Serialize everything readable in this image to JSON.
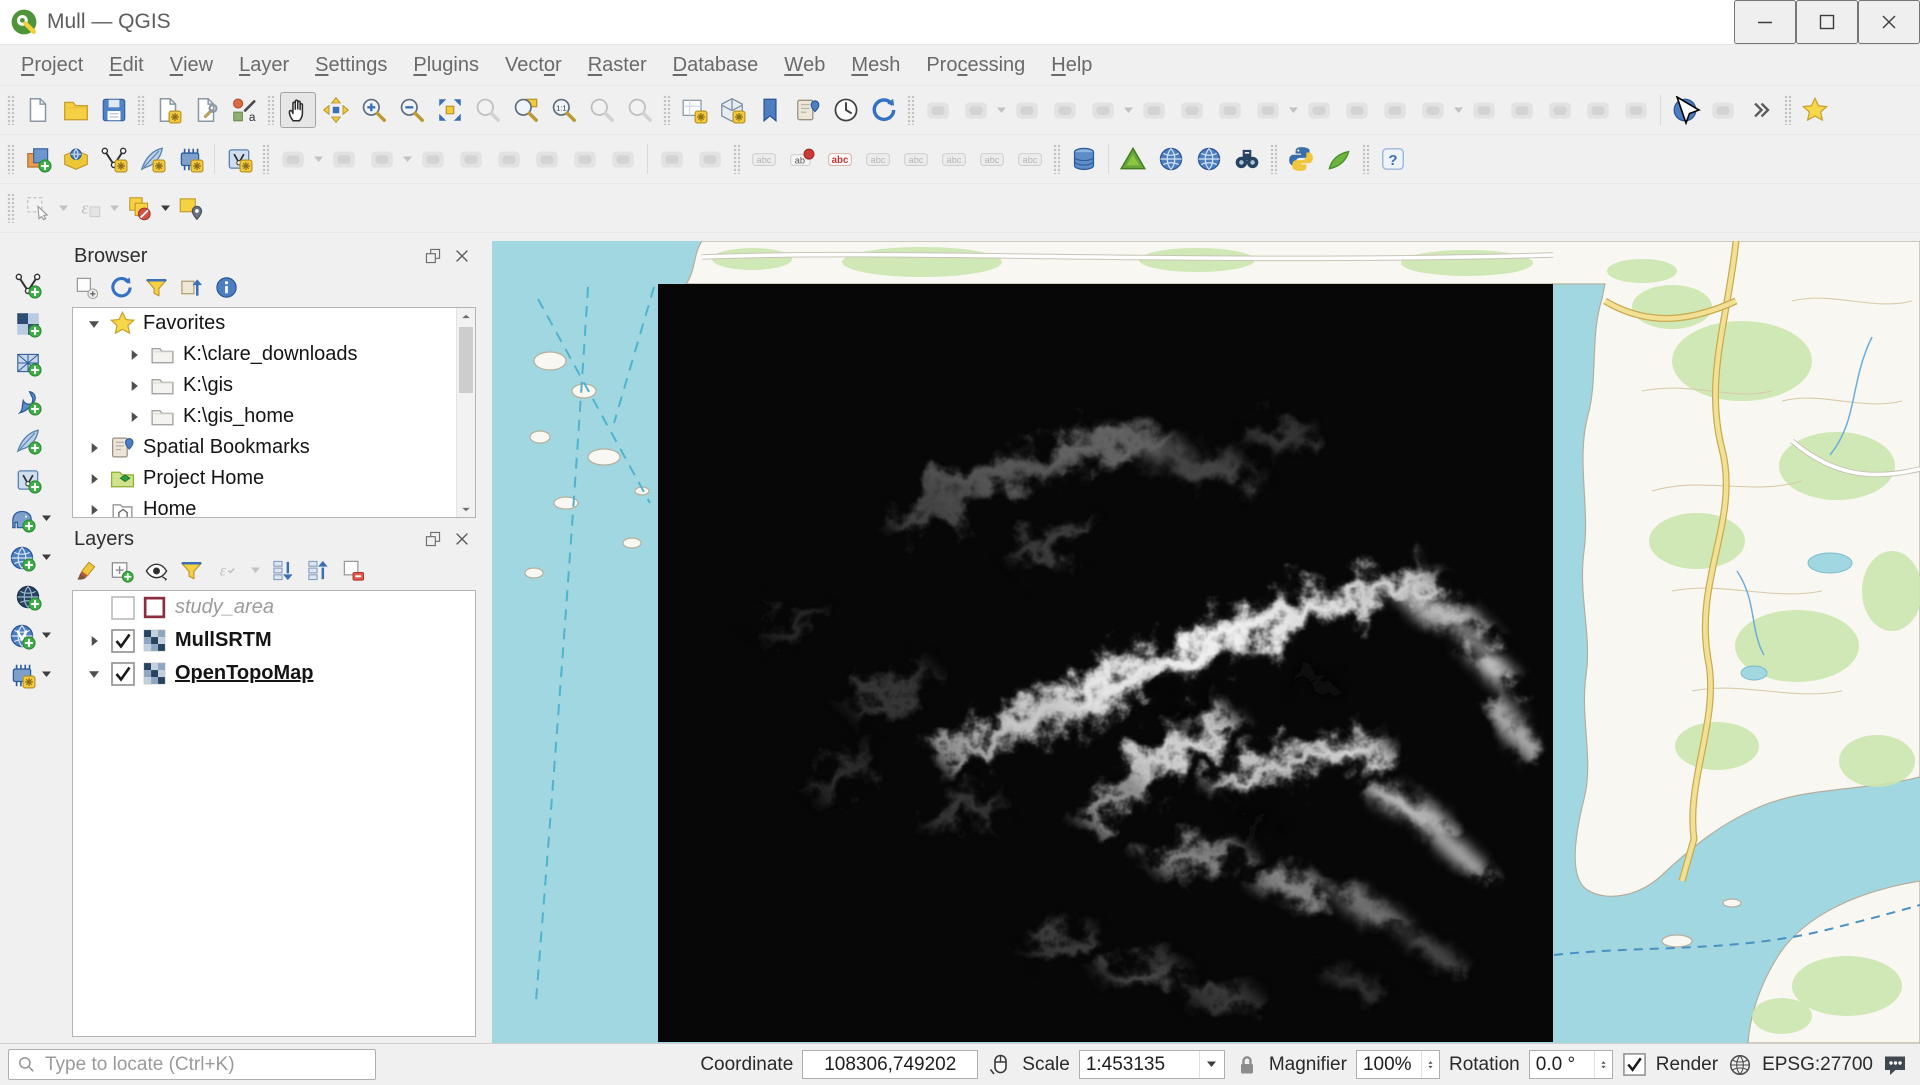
{
  "window": {
    "title": "Mull — QGIS"
  },
  "menu": {
    "items": [
      {
        "label": "Project",
        "u": 0
      },
      {
        "label": "Edit",
        "u": 0
      },
      {
        "label": "View",
        "u": 0
      },
      {
        "label": "Layer",
        "u": 0
      },
      {
        "label": "Settings",
        "u": 0
      },
      {
        "label": "Plugins",
        "u": 0
      },
      {
        "label": "Vector",
        "u": 4
      },
      {
        "label": "Raster",
        "u": 0
      },
      {
        "label": "Database",
        "u": 0
      },
      {
        "label": "Web",
        "u": 0
      },
      {
        "label": "Mesh",
        "u": 0
      },
      {
        "label": "Processing",
        "u": 3
      },
      {
        "label": "Help",
        "u": 0
      }
    ]
  },
  "toolbar1": [
    {
      "t": "handle"
    },
    {
      "n": "new-project",
      "i": "page"
    },
    {
      "n": "open-project",
      "i": "folder"
    },
    {
      "n": "save-project",
      "i": "floppy"
    },
    {
      "t": "handle"
    },
    {
      "n": "new-print-layout",
      "i": "pageStar"
    },
    {
      "n": "show-layout-manager",
      "i": "pageWrench"
    },
    {
      "n": "style-manager",
      "i": "styleMgr"
    },
    {
      "t": "handle"
    },
    {
      "n": "pan-map",
      "i": "hand",
      "pressed": true
    },
    {
      "n": "pan-map-to-selection",
      "i": "move"
    },
    {
      "n": "zoom-in",
      "i": "magPlus"
    },
    {
      "n": "zoom-out",
      "i": "magMinus"
    },
    {
      "n": "zoom-full",
      "i": "zoomFull"
    },
    {
      "n": "zoom-to-selection",
      "i": "magGray"
    },
    {
      "n": "zoom-to-layer",
      "i": "magLayer"
    },
    {
      "n": "zoom-to-native",
      "i": "mag11"
    },
    {
      "n": "zoom-last",
      "i": "magGray"
    },
    {
      "n": "zoom-next",
      "i": "magGray"
    },
    {
      "t": "handle"
    },
    {
      "n": "new-map-view",
      "i": "mapView"
    },
    {
      "n": "new-3d-map-view",
      "i": "cube3d"
    },
    {
      "n": "new-spatial-bookmark",
      "i": "bookmarkBlue"
    },
    {
      "n": "show-spatial-bookmarks",
      "i": "bookPin"
    },
    {
      "n": "temporal-controller",
      "i": "clock"
    },
    {
      "n": "refresh-map",
      "i": "refresh"
    },
    {
      "t": "handle"
    },
    {
      "n": "inactive-tool-1",
      "i": "genericGray"
    },
    {
      "n": "inactive-tool-2",
      "i": "genericGray",
      "caret": "dim"
    },
    {
      "n": "inactive-tool-3",
      "i": "genericGray"
    },
    {
      "n": "inactive-tool-4",
      "i": "genericGray"
    },
    {
      "n": "inactive-tool-5",
      "i": "genericGray",
      "caret": "dim"
    },
    {
      "n": "inactive-tool-6",
      "i": "genericGray"
    },
    {
      "n": "inactive-tool-7",
      "i": "genericGray"
    },
    {
      "n": "inactive-tool-8",
      "i": "genericGray"
    },
    {
      "n": "inactive-tool-9",
      "i": "genericGray",
      "caret": "dim"
    },
    {
      "n": "inactive-tool-10",
      "i": "genericGray"
    },
    {
      "n": "inactive-tool-11",
      "i": "genericGray"
    },
    {
      "n": "inactive-tool-12",
      "i": "genericGray"
    },
    {
      "n": "inactive-tool-13",
      "i": "genericGray",
      "caret": "dim"
    },
    {
      "n": "inactive-tool-14",
      "i": "genericGray"
    },
    {
      "n": "inactive-tool-15",
      "i": "genericGray"
    },
    {
      "n": "inactive-tool-16",
      "i": "genericGray"
    },
    {
      "n": "inactive-tool-17",
      "i": "genericGray"
    },
    {
      "n": "inactive-tool-18",
      "i": "genericGray"
    },
    {
      "t": "sep"
    },
    {
      "n": "information-tool",
      "i": "infoBlue"
    },
    {
      "n": "inactive-tool-19",
      "i": "genericGray"
    },
    {
      "n": "toolbar-overflow",
      "i": "chevrons"
    },
    {
      "t": "handle"
    },
    {
      "n": "favorites",
      "i": "star"
    }
  ],
  "toolbar2": [
    {
      "t": "handle"
    },
    {
      "n": "open-data-source-manager",
      "i": "stackPlus"
    },
    {
      "n": "browser-data-source",
      "i": "boxGlobe"
    },
    {
      "n": "add-vector-layer",
      "i": "vnodeY"
    },
    {
      "n": "add-spatialite-layer",
      "i": "featherY"
    },
    {
      "n": "add-mesh-layer",
      "i": "chipY"
    },
    {
      "t": "sep"
    },
    {
      "n": "add-virtual-layer",
      "i": "vboxY"
    },
    {
      "t": "handle"
    },
    {
      "n": "current-edits",
      "i": "genericGray",
      "caret": "dim"
    },
    {
      "n": "toggle-editing",
      "i": "genericGray"
    },
    {
      "n": "save-layer-edits",
      "i": "genericGray",
      "caret": "dim"
    },
    {
      "n": "digitize-tool-1",
      "i": "genericGray"
    },
    {
      "n": "digitize-tool-2",
      "i": "genericGray"
    },
    {
      "n": "delete-selected",
      "i": "genericGray"
    },
    {
      "n": "cut-features",
      "i": "genericGray"
    },
    {
      "n": "copy-features",
      "i": "genericGray"
    },
    {
      "n": "paste-features",
      "i": "genericGray"
    },
    {
      "t": "sep"
    },
    {
      "n": "undo",
      "i": "genericGray"
    },
    {
      "n": "redo",
      "i": "genericGray"
    },
    {
      "t": "handle"
    },
    {
      "n": "label-tool-1",
      "i": "pillGray"
    },
    {
      "n": "highlight-pinned-labels",
      "i": "pillRedDot"
    },
    {
      "n": "layer-labeling",
      "i": "pillAbcRed"
    },
    {
      "n": "label-tool-2",
      "i": "pillGray"
    },
    {
      "n": "label-tool-3",
      "i": "pillGray"
    },
    {
      "n": "label-tool-4",
      "i": "pillGray"
    },
    {
      "n": "label-tool-5",
      "i": "pillGray"
    },
    {
      "n": "label-tool-6",
      "i": "pillGray"
    },
    {
      "t": "handle"
    },
    {
      "n": "db-manager",
      "i": "dbCyl"
    },
    {
      "t": "sep"
    },
    {
      "n": "grass-tools",
      "i": "grass"
    },
    {
      "n": "web-service-1",
      "i": "globe"
    },
    {
      "n": "web-service-2",
      "i": "globe"
    },
    {
      "n": "osm-place-search",
      "i": "binoculars"
    },
    {
      "t": "handle"
    },
    {
      "n": "python-console",
      "i": "python"
    },
    {
      "n": "processing-toolbox",
      "i": "greenPoly"
    },
    {
      "t": "handle"
    },
    {
      "n": "help-contents",
      "i": "help"
    }
  ],
  "toolbar3": [
    {
      "t": "handle"
    },
    {
      "n": "select-features",
      "i": "selectRect",
      "caret": "dim"
    },
    {
      "n": "select-by-expression",
      "i": "epsilonSel",
      "caret": "dim"
    },
    {
      "n": "deselect-all",
      "i": "yellowSquares",
      "caret": "dark"
    },
    {
      "n": "select-by-value",
      "i": "yellowPin"
    }
  ],
  "left_toolbar": [
    {
      "n": "add-vector-layer",
      "i": "vnodeG"
    },
    {
      "n": "add-raster-layer",
      "i": "rasterG"
    },
    {
      "n": "add-mesh-layer",
      "i": "meshG"
    },
    {
      "n": "add-delimited-text-layer",
      "i": "commaG"
    },
    {
      "n": "add-spatialite-layer",
      "i": "featherG"
    },
    {
      "n": "add-virtual-layer",
      "i": "vboxG"
    },
    {
      "n": "add-postgis-layer",
      "i": "elephantG",
      "caret": "dark"
    },
    {
      "n": "add-wms-layer",
      "i": "globeG",
      "caret": "dark"
    },
    {
      "n": "add-wcs-layer",
      "i": "globeDarkG"
    },
    {
      "n": "add-wfs-layer",
      "i": "globeVG",
      "caret": "dark"
    },
    {
      "n": "add-mesh-chip-layer",
      "i": "chipY",
      "caret": "dark"
    }
  ],
  "browser": {
    "title": "Browser",
    "tools": [
      {
        "n": "add-selected-layers",
        "i": "squarePlus"
      },
      {
        "n": "refresh-browser",
        "i": "refresh"
      },
      {
        "n": "filter-browser",
        "i": "funnel"
      },
      {
        "n": "collapse-all",
        "i": "collapseFolder"
      },
      {
        "n": "enable-properties",
        "i": "infoBlue"
      }
    ],
    "items": [
      {
        "label": "Favorites",
        "icon": "star",
        "expander": "open",
        "level": 0
      },
      {
        "label": "K:\\clare_downloads",
        "icon": "folderTree",
        "expander": "closed",
        "level": 1
      },
      {
        "label": "K:\\gis",
        "icon": "folderTree",
        "expander": "closed",
        "level": 1
      },
      {
        "label": "K:\\gis_home",
        "icon": "folderTree",
        "expander": "closed",
        "level": 1
      },
      {
        "label": "Spatial Bookmarks",
        "icon": "bookPin",
        "expander": "closed",
        "level": 0
      },
      {
        "label": "Project Home",
        "icon": "folderGreen",
        "expander": "closed",
        "level": 0
      },
      {
        "label": "Home",
        "icon": "homeIcon",
        "expander": "closed",
        "level": 0
      }
    ]
  },
  "layers_panel": {
    "title": "Layers",
    "tools": [
      {
        "n": "open-layer-styling",
        "i": "brush"
      },
      {
        "n": "add-group",
        "i": "boxPlus"
      },
      {
        "n": "manage-map-themes",
        "i": "eye"
      },
      {
        "n": "filter-legend",
        "i": "funnel"
      },
      {
        "n": "filter-by-expression",
        "i": "epsilonGray",
        "caret": "dim"
      },
      {
        "n": "expand-all",
        "i": "expandAll"
      },
      {
        "n": "collapse-all",
        "i": "collapseAll"
      },
      {
        "n": "remove-layer",
        "i": "removeLayer"
      }
    ],
    "layers": [
      {
        "name": "study_area",
        "checked": false,
        "icon": "studyArea",
        "style": "italic",
        "expander": "none"
      },
      {
        "name": "MullSRTM",
        "checked": true,
        "icon": "checker",
        "style": "bold",
        "expander": "closed"
      },
      {
        "name": "OpenTopoMap",
        "checked": true,
        "icon": "checker",
        "style": "boldu",
        "expander": "open"
      }
    ]
  },
  "statusbar": {
    "locate_placeholder": "Type to locate (Ctrl+K)",
    "coordinate_label": "Coordinate",
    "coordinate_value": "108306,749202",
    "scale_label": "Scale",
    "scale_value": "1:453135",
    "magnifier_label": "Magnifier",
    "magnifier_value": "100%",
    "rotation_label": "Rotation",
    "rotation_value": "0.0 °",
    "render_label": "Render",
    "render_checked": true,
    "crs": "EPSG:27700"
  },
  "colors": {
    "sea": "#a0d7e1",
    "land": "#f9f7f1",
    "forest": "#cbe5ae",
    "road": "#f2e195",
    "road_casing": "#c9ab51",
    "boundary": "#4fb3cf",
    "accent_blue": "#3b6fb6",
    "accent_yellow": "#f3c93e",
    "raster_black": "#070707"
  }
}
